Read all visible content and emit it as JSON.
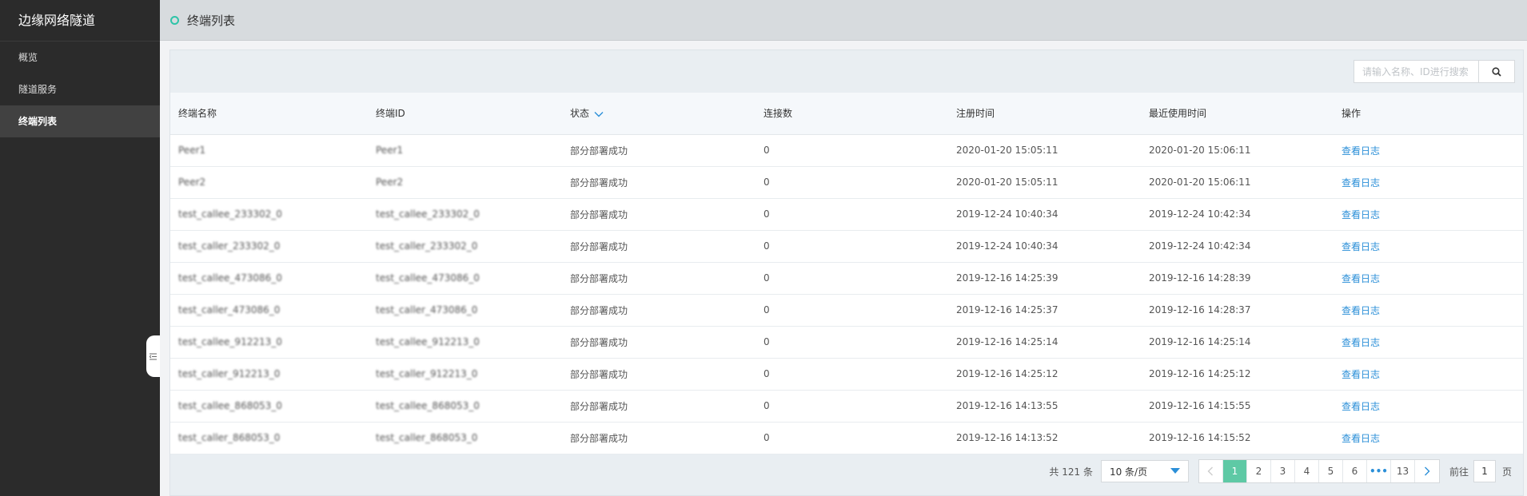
{
  "sidebar": {
    "title": "边缘网络隧道",
    "items": [
      {
        "label": "概览",
        "active": false
      },
      {
        "label": "隧道服务",
        "active": false
      },
      {
        "label": "终端列表",
        "active": true
      }
    ],
    "collapse_icon": "collapse-sidebar-icon"
  },
  "header": {
    "title": "终端列表"
  },
  "search": {
    "placeholder": "请输入名称、ID进行搜索",
    "value": "",
    "icon": "search-icon"
  },
  "table": {
    "columns": [
      "终端名称",
      "终端ID",
      "状态",
      "连接数",
      "注册时间",
      "最近使用时间",
      "操作"
    ],
    "rows": [
      [
        "Peer1",
        "Peer1",
        "部分部署成功",
        "0",
        "2020-01-20 15:05:11",
        "2020-01-20 15:06:11",
        "查看日志"
      ],
      [
        "Peer2",
        "Peer2",
        "部分部署成功",
        "0",
        "2020-01-20 15:05:11",
        "2020-01-20 15:06:11",
        "查看日志"
      ],
      [
        "test_callee_233302_0",
        "test_callee_233302_0",
        "部分部署成功",
        "0",
        "2019-12-24 10:40:34",
        "2019-12-24 10:42:34",
        "查看日志"
      ],
      [
        "test_caller_233302_0",
        "test_caller_233302_0",
        "部分部署成功",
        "0",
        "2019-12-24 10:40:34",
        "2019-12-24 10:42:34",
        "查看日志"
      ],
      [
        "test_callee_473086_0",
        "test_callee_473086_0",
        "部分部署成功",
        "0",
        "2019-12-16 14:25:39",
        "2019-12-16 14:28:39",
        "查看日志"
      ],
      [
        "test_caller_473086_0",
        "test_caller_473086_0",
        "部分部署成功",
        "0",
        "2019-12-16 14:25:37",
        "2019-12-16 14:28:37",
        "查看日志"
      ],
      [
        "test_callee_912213_0",
        "test_callee_912213_0",
        "部分部署成功",
        "0",
        "2019-12-16 14:25:14",
        "2019-12-16 14:25:14",
        "查看日志"
      ],
      [
        "test_caller_912213_0",
        "test_caller_912213_0",
        "部分部署成功",
        "0",
        "2019-12-16 14:25:12",
        "2019-12-16 14:25:12",
        "查看日志"
      ],
      [
        "test_callee_868053_0",
        "test_callee_868053_0",
        "部分部署成功",
        "0",
        "2019-12-16 14:13:55",
        "2019-12-16 14:15:55",
        "查看日志"
      ],
      [
        "test_caller_868053_0",
        "test_caller_868053_0",
        "部分部署成功",
        "0",
        "2019-12-16 14:13:52",
        "2019-12-16 14:15:52",
        "查看日志"
      ]
    ]
  },
  "pagination": {
    "total": "共 121 条",
    "page_size": "10 条/页",
    "pages": [
      "1",
      "2",
      "3",
      "4",
      "5",
      "6",
      "•••",
      "13"
    ],
    "current": "1",
    "jump_prefix": "前往",
    "jump_value": "1",
    "jump_suffix": "页"
  },
  "colors": {
    "sidebar_bg": "#2b2b2b",
    "accent": "#5ec9a5",
    "status_green": "#2cba5c",
    "link_blue": "#2b8fd8"
  }
}
